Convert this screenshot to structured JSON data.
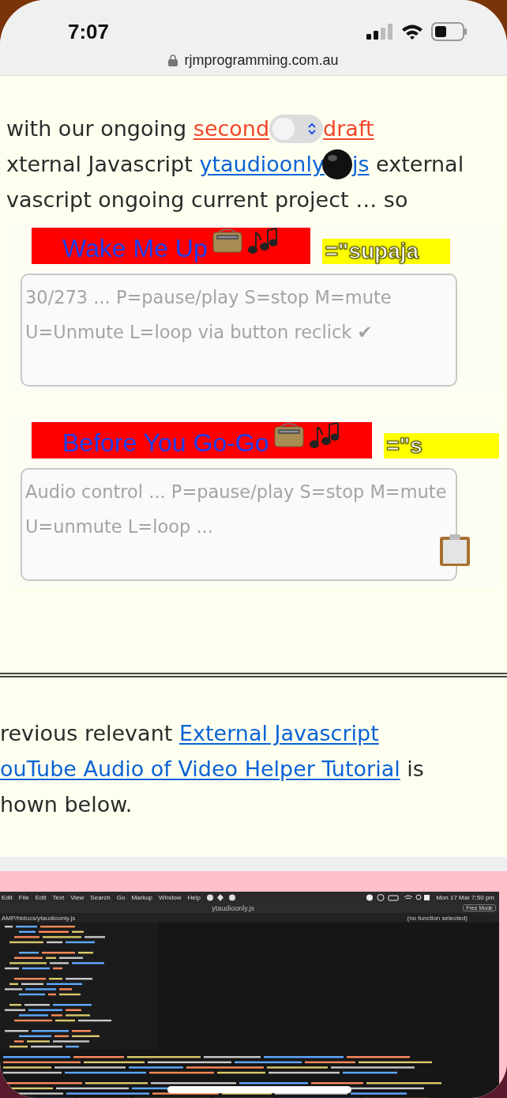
{
  "status_bar": {
    "time": "7:07"
  },
  "address_bar": {
    "domain": "rjmprogramming.com.au"
  },
  "intro_lines": [
    [
      {
        "kind": "text",
        "text": "with our ongoing "
      },
      {
        "kind": "link",
        "text": "second",
        "color": "#f2472b"
      },
      {
        "kind": "toggle",
        "on": false
      },
      {
        "kind": "link",
        "text": "draft",
        "color": "#f2472b"
      }
    ],
    [
      {
        "kind": "text",
        "text": "xternal Javascript "
      },
      {
        "kind": "link",
        "text": "ytaudioonly",
        "color": "#0a63d6"
      },
      {
        "kind": "ball"
      },
      {
        "kind": "link",
        "text": "js",
        "color": "#0a63d6"
      },
      {
        "kind": "text",
        "text": " external"
      }
    ],
    [
      {
        "kind": "text",
        "text": "vascript ongoing current project … so"
      }
    ]
  ],
  "players": [
    {
      "title": "Wake Me Up",
      "tag": "=\"supaja",
      "placeholder": "30/273 ... P=pause/play S=stop M=mute U=Unmute L=loop via button reclick ✔",
      "clipboard": false
    },
    {
      "title": "Before You Go-Go",
      "tag": "=\"s",
      "placeholder": "Audio control ... P=pause/play S=stop M=mute U=unmute L=loop ...",
      "clipboard": true
    }
  ],
  "outro_lines": [
    [
      {
        "kind": "text",
        "text": "revious relevant "
      },
      {
        "kind": "link",
        "text": "External Javascript",
        "color": "#0a63d6"
      }
    ],
    [
      {
        "kind": "link",
        "text": "ouTube Audio of Video Helper Tutorial",
        "color": "#0a63d6"
      },
      {
        "kind": "text",
        "text": " is"
      }
    ],
    [
      {
        "kind": "text",
        "text": "hown below."
      }
    ]
  ],
  "embedded_screenshot": {
    "menu": [
      "Edit",
      "File",
      "Edit",
      "Text",
      "View",
      "Search",
      "Go",
      "Markup",
      "Window",
      "Help"
    ],
    "clock": "Mon 17 Mar  7:50 pm",
    "file_title": "ytaudioonly.js",
    "mode_button": "Free Mode",
    "path": "AMP/htdocs/ytaudioonly.js",
    "function_menu": "(no function selected)"
  }
}
